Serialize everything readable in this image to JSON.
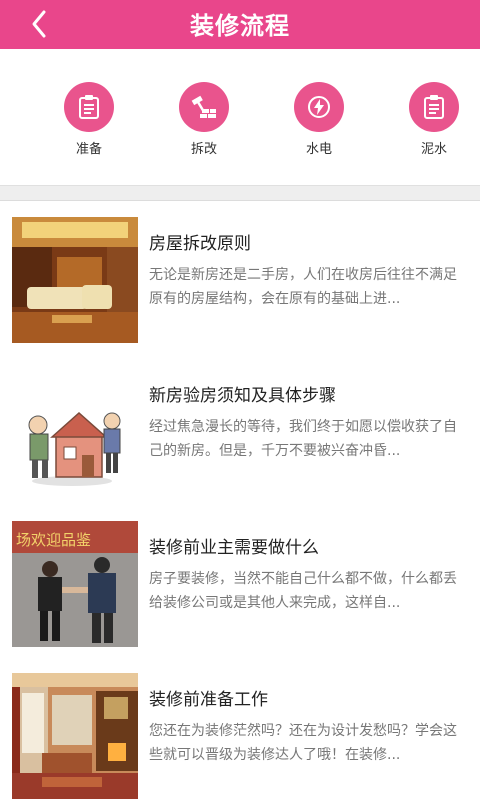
{
  "header": {
    "title": "装修流程"
  },
  "steps": [
    {
      "label": "准备",
      "icon": "clipboard-icon"
    },
    {
      "label": "拆改",
      "icon": "hammer-bricks-icon"
    },
    {
      "label": "水电",
      "icon": "lightning-icon"
    },
    {
      "label": "泥水",
      "icon": "clipboard-icon"
    }
  ],
  "articles": [
    {
      "title": "房屋拆改原则",
      "desc": "无论是新房还是二手房，人们在收房后往往不满足原有的房屋结构，会在原有的基础上进..."
    },
    {
      "title": "新房验房须知及具体步骤",
      "desc": "经过焦急漫长的等待，我们终于如愿以偿收获了自己的新房。但是，千万不要被兴奋冲昏..."
    },
    {
      "title": "装修前业主需要做什么",
      "desc": "房子要装修，当然不能自己什么都不做，什么都丢给装修公司或是其他人来完成，这样自..."
    },
    {
      "title": "装修前准备工作",
      "desc": "您还在为装修茫然吗？还在为设计发愁吗？学会这些就可以晋级为装修达人了哦！在装修..."
    }
  ],
  "colors": {
    "brand": "#e9468b",
    "icon_bg": "#e9548d"
  }
}
